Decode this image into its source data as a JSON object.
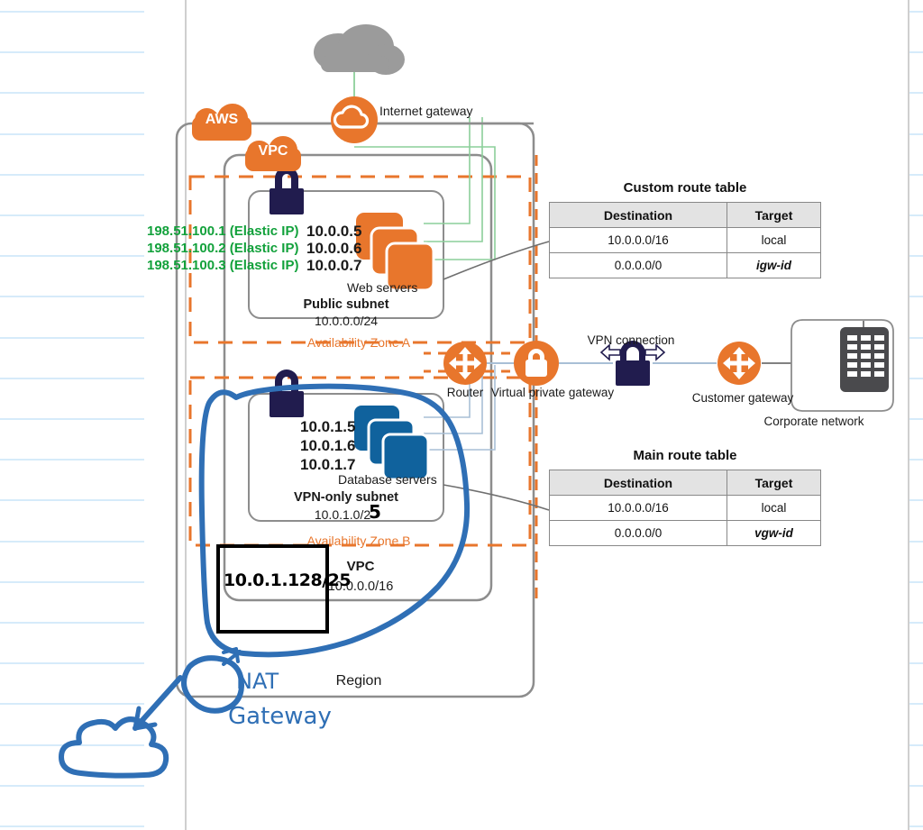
{
  "diagram": {
    "title_badges": {
      "aws": "AWS",
      "vpc": "VPC"
    },
    "region_label": "Region",
    "vpc_label": "VPC",
    "vpc_cidr": "10.0.0.0/16",
    "internet_gateway": "Internet gateway",
    "availability_zone_a": "Availability Zone A",
    "availability_zone_b": "Availability Zone B",
    "router": "Router",
    "virtual_private_gateway": "Virtual private gateway",
    "vpn_connection": "VPN connection",
    "customer_gateway": "Customer gateway",
    "corporate_network": "Corporate network"
  },
  "public_subnet": {
    "name": "Public subnet",
    "cidr": "10.0.0.0/24",
    "servers_label": "Web servers",
    "private_ips": [
      "10.0.0.5",
      "10.0.0.6",
      "10.0.0.7"
    ],
    "elastic_ips": [
      {
        "ip": "198.51.100.1",
        "tag": "(Elastic IP)"
      },
      {
        "ip": "198.51.100.2",
        "tag": "(Elastic IP)"
      },
      {
        "ip": "198.51.100.3",
        "tag": "(Elastic IP)"
      }
    ]
  },
  "private_subnet": {
    "name": "VPN-only subnet",
    "cidr": "10.0.1.0/2",
    "cidr_overwrite": "5",
    "servers_label": "Database servers",
    "private_ips": [
      "10.0.1.5",
      "10.0.1.6",
      "10.0.1.7"
    ]
  },
  "custom_route_table": {
    "title": "Custom route table",
    "headers": [
      "Destination",
      "Target"
    ],
    "rows": [
      {
        "destination": "10.0.0.0/16",
        "target": "local"
      },
      {
        "destination": "0.0.0.0/0",
        "target": "igw-id"
      }
    ]
  },
  "main_route_table": {
    "title": "Main route table",
    "headers": [
      "Destination",
      "Target"
    ],
    "rows": [
      {
        "destination": "10.0.0.0/16",
        "target": "local"
      },
      {
        "destination": "0.0.0.0/0",
        "target": "vgw-id"
      }
    ]
  },
  "annotations": {
    "subnet_cidr_note": "10.0.1.128/25",
    "nat_label_line1": "NAT",
    "nat_label_line2": "Gateway"
  },
  "colors": {
    "aws_orange": "#E8762C",
    "navy": "#211C4E",
    "green": "#12a13b",
    "blue_ink": "#2F6FB5",
    "db_blue": "#10629D",
    "dark_gray": "#4A4A4D"
  }
}
